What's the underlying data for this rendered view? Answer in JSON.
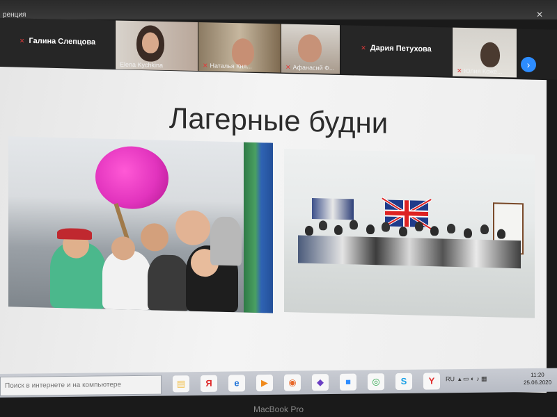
{
  "window": {
    "title": "ренция"
  },
  "participants": [
    {
      "name": "Галина Слепцова",
      "type": "name-only"
    },
    {
      "name": "Elena Kychkina",
      "type": "video"
    },
    {
      "name": "Наталья Кня...",
      "type": "video",
      "muted": true
    },
    {
      "name": "Афанасий Ф...",
      "type": "video",
      "muted": true
    },
    {
      "name": "Дария Петухова",
      "type": "name-only"
    },
    {
      "name": "Юлия Коже...",
      "type": "video",
      "muted": true
    }
  ],
  "slide": {
    "title": "Лагерные будни"
  },
  "taskbar": {
    "search_placeholder": "Поиск в интернете и на компьютере",
    "apps": [
      {
        "icon": "file-explorer-icon",
        "glyph": "▤",
        "color": "#f2c14e"
      },
      {
        "icon": "yandex-icon",
        "glyph": "Я",
        "color": "#e02a2a"
      },
      {
        "icon": "internet-explorer-icon",
        "glyph": "e",
        "color": "#1e73d8"
      },
      {
        "icon": "media-player-icon",
        "glyph": "▶",
        "color": "#f08a1c"
      },
      {
        "icon": "firefox-icon",
        "glyph": "◉",
        "color": "#e8682a"
      },
      {
        "icon": "vlc-icon",
        "glyph": "◆",
        "color": "#6b3fc4"
      },
      {
        "icon": "zoom-icon",
        "glyph": "■",
        "color": "#2d8cff"
      },
      {
        "icon": "chrome-icon",
        "glyph": "◎",
        "color": "#2ea84d"
      },
      {
        "icon": "skype-icon",
        "glyph": "S",
        "color": "#1aa0e6"
      },
      {
        "icon": "yandex-browser-icon",
        "glyph": "Y",
        "color": "#e02a2a"
      }
    ],
    "language": "RU",
    "time": "11:20",
    "date": "25.06.2020"
  },
  "device_brand": "MacBook Pro"
}
